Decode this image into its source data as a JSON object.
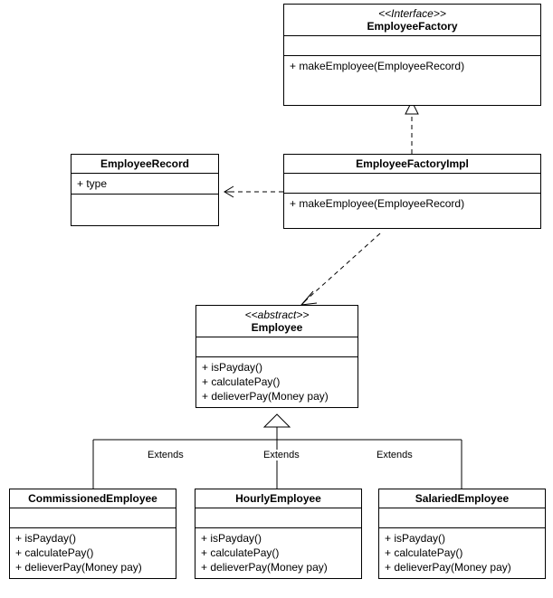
{
  "classes": {
    "employeeFactory": {
      "stereotype": "<<Interface>>",
      "name": "EmployeeFactory",
      "methods": [
        "+ makeEmployee(EmployeeRecord)"
      ]
    },
    "employeeRecord": {
      "name": "EmployeeRecord",
      "attrs": [
        "+ type"
      ]
    },
    "employeeFactoryImpl": {
      "name": "EmployeeFactoryImpl",
      "methods": [
        "+ makeEmployee(EmployeeRecord)"
      ]
    },
    "employee": {
      "stereotype": "<<abstract>>",
      "name": "Employee",
      "methods": [
        "+ isPayday()",
        "+ calculatePay()",
        "+ delieverPay(Money pay)"
      ]
    },
    "commissionedEmployee": {
      "name": "CommissionedEmployee",
      "methods": [
        "+ isPayday()",
        "+ calculatePay()",
        "+ delieverPay(Money pay)"
      ]
    },
    "hourlyEmployee": {
      "name": "HourlyEmployee",
      "methods": [
        "+ isPayday()",
        "+ calculatePay()",
        "+ delieverPay(Money pay)"
      ]
    },
    "salariedEmployee": {
      "name": "SalariedEmployee",
      "methods": [
        "+ isPayday()",
        "+ calculatePay()",
        "+ delieverPay(Money pay)"
      ]
    }
  },
  "labels": {
    "extends1": "Extends",
    "extends2": "Extends",
    "extends3": "Extends"
  }
}
